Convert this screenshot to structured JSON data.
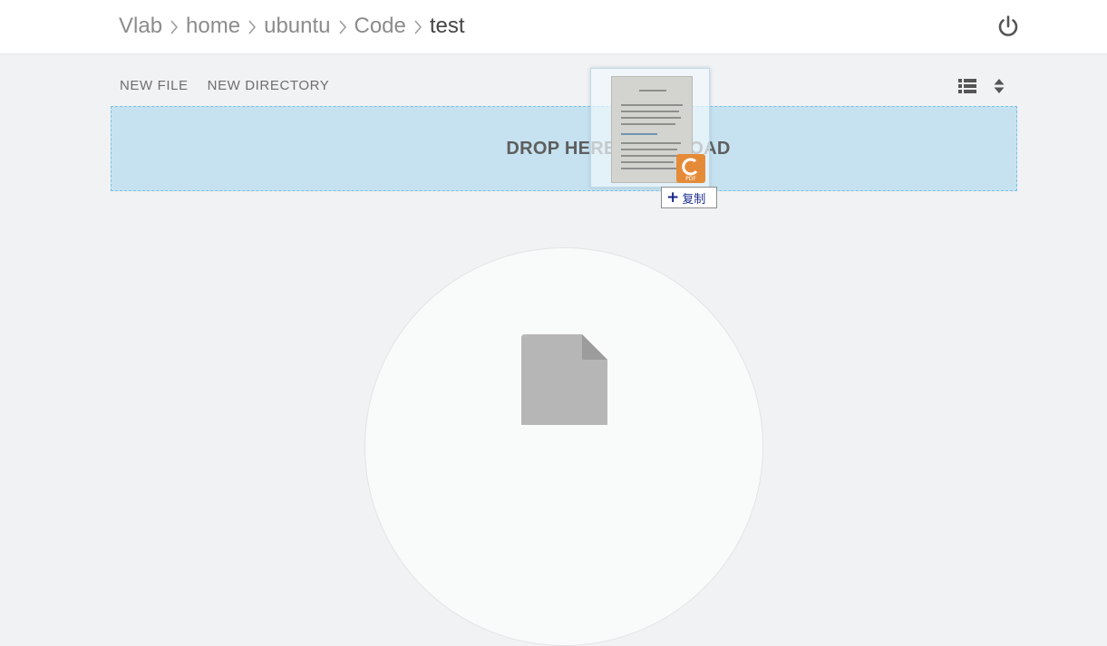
{
  "breadcrumb": {
    "items": [
      {
        "label": "Vlab"
      },
      {
        "label": "home"
      },
      {
        "label": "ubuntu"
      },
      {
        "label": "Code"
      },
      {
        "label": "test"
      }
    ]
  },
  "header": {
    "power_icon": "power-icon"
  },
  "toolbar": {
    "new_file_label": "NEW FILE",
    "new_directory_label": "NEW DIRECTORY",
    "view_icon": "list-view-icon",
    "sort_icon": "sort-icon"
  },
  "dropzone": {
    "label": "DROP HERE TO UPLOAD"
  },
  "drag_preview": {
    "copy_label": "复制",
    "badge_text": "PDF"
  },
  "empty_state": {
    "icon": "file-icon"
  },
  "colors": {
    "dropzone_bg": "#c6e2f0",
    "dropzone_border": "#79c0e4",
    "pdf_badge": "#e58b38"
  }
}
